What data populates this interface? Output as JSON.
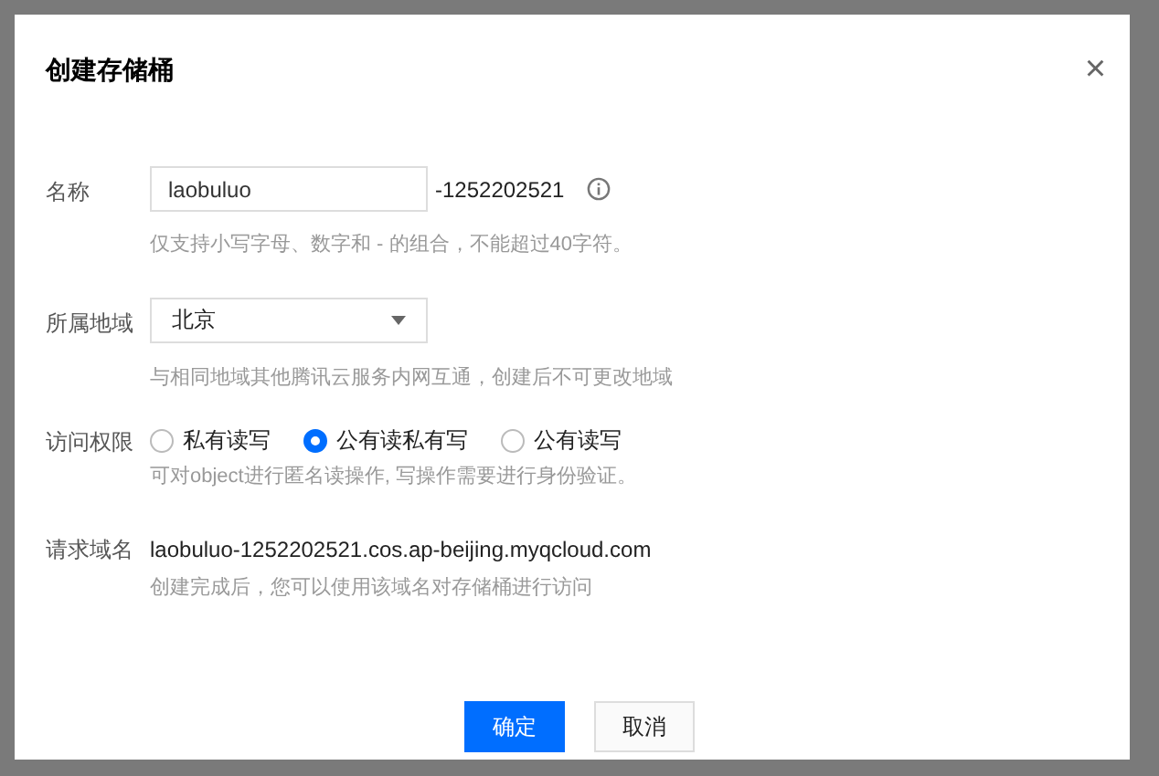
{
  "dialog": {
    "title": "创建存储桶",
    "close": "×"
  },
  "name": {
    "label": "名称",
    "value": "laobuluo",
    "suffix": "-1252202521",
    "hint": "仅支持小写字母、数字和 - 的组合，不能超过40字符。"
  },
  "region": {
    "label": "所属地域",
    "value": "北京",
    "hint": "与相同地域其他腾讯云服务内网互通，创建后不可更改地域"
  },
  "access": {
    "label": "访问权限",
    "options": [
      {
        "label": "私有读写",
        "selected": false
      },
      {
        "label": "公有读私有写",
        "selected": true
      },
      {
        "label": "公有读写",
        "selected": false
      }
    ],
    "hint": "可对object进行匿名读操作, 写操作需要进行身份验证。"
  },
  "domain": {
    "label": "请求域名",
    "value": "laobuluo-1252202521.cos.ap-beijing.myqcloud.com",
    "hint": "创建完成后，您可以使用该域名对存储桶进行访问"
  },
  "buttons": [
    {
      "label": "确定",
      "kind": "primary"
    },
    {
      "label": "取消",
      "kind": "secondary"
    }
  ]
}
